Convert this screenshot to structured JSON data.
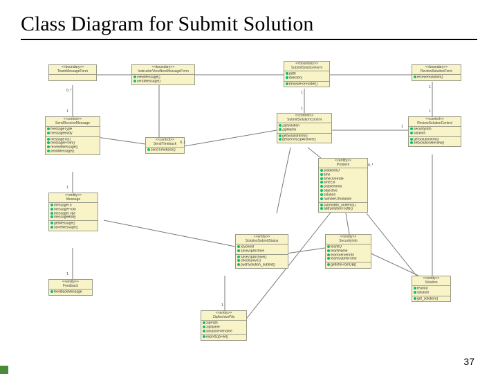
{
  "page": {
    "title": "Class Diagram for Submit Solution",
    "number": "37"
  },
  "classes": {
    "teamMessageForm": {
      "stereo": "<<boundary>>",
      "name": "TeamMessageForm"
    },
    "instructorViewMessageForm": {
      "stereo": "<<boundary>>",
      "name": "InstructorViewNewMessageForm",
      "ops": [
        "viewMessage()",
        "sendMessage()"
      ]
    },
    "submitSolutionForm": {
      "stereo": "<<boundary>>",
      "name": "SubmitSolutionForm",
      "attrs": [
        "path",
        "directory"
      ],
      "ops": [
        "browseForFolder()"
      ]
    },
    "reviewSolutionForm": {
      "stereo": "<<boundary>>",
      "name": "ReviewSolutionForm",
      "ops": [
        "receiveSolution()"
      ]
    },
    "sendReceiveMessage": {
      "stereo": "<<control>>",
      "name": "SendReceiveMessage",
      "attrs": [
        "messageType",
        "messageBody"
      ],
      "ops": [
        "messageTo()",
        "messageFrom()",
        "receiveMessage()",
        "sendMessage()"
      ]
    },
    "sendTimeback": {
      "stereo": "<<control>>",
      "name": "SendTimeback",
      "ops": [
        "sendTimeback()"
      ]
    },
    "submitSolutionControl": {
      "stereo": "<<control>>",
      "name": "SubmitSolutionControl",
      "attrs": [
        "ZipSolution",
        "ZipName"
      ],
      "ops": [
        "getSolutionInfo()",
        "getServerZipArchive()"
      ]
    },
    "reviewSolutionControl": {
      "stereo": "<<control>>",
      "name": "ReviewSolutionControl",
      "attrs": [
        "securityInfo",
        "solution"
      ],
      "ops": [
        "getSolutionInfo()",
        "setSolutionReview()"
      ]
    },
    "problem": {
      "stereo": "<<entity>>",
      "name": "Problem",
      "attrs": [
        "problemID",
        "time",
        "timeOverride",
        "timeExt",
        "problemInfo",
        "objective",
        "solution",
        "numberOfSolution"
      ],
      "ops": [
        "submitBtn_onItems()",
        "addSolutionToDB()"
      ]
    },
    "message": {
      "stereo": "<<entity>>",
      "name": "Message",
      "attrs": [
        "messageTo",
        "messageFrom",
        "messageType",
        "messageBody"
      ],
      "ops": [
        "getMessage()",
        "storeMessage()"
      ]
    },
    "solutionSubmitStatus": {
      "stereo": "<<entity>>",
      "name": "SolutionSubmitStatus",
      "attrs": [
        "isSolved",
        "saveZipArchive"
      ],
      "ops": [
        "saveZipArchive()",
        "checkSolve()",
        "pushSolution_submit()"
      ]
    },
    "securityInfo": {
      "stereo": "<<entity>>",
      "name": "SecurityInfo",
      "attrs": [
        "teamID",
        "teamName",
        "teamServerInfo",
        "teamSubmitTime"
      ],
      "ops": [
        "getInfoFromDB()"
      ]
    },
    "feedback": {
      "stereo": "<<entity>>",
      "name": "Feedback",
      "attrs": [
        "feedbackMessage"
      ]
    },
    "zipArchiveFile": {
      "stereo": "<<entity>>",
      "name": "ZipArchiveFile",
      "attrs": [
        "zipPath",
        "zipName",
        "solutionFilename"
      ],
      "ops": [
        "exportZipFile()"
      ]
    },
    "solution": {
      "stereo": "<<entity>>",
      "name": "Solution",
      "attrs": [
        "teamID",
        "solution"
      ],
      "ops": [
        "get_solution()"
      ]
    }
  },
  "multiplicities": {
    "zero_star": "0..*",
    "one": "1",
    "zero_one": "0..1"
  }
}
